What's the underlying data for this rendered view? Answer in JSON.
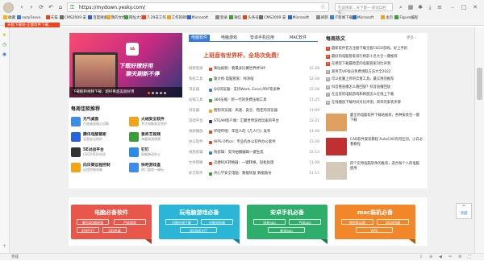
{
  "browser": {
    "url": "https://mydown.yesky.com/",
    "search_placeholder": "在此搜索…天下第一·新冠口腔科…",
    "tab_title": "天极下载站-正版软件下载…",
    "status_text": "完成",
    "bookmarks": [
      {
        "label": "收藏",
        "color": "#f5b400"
      },
      {
        "label": "sezy5ssvn",
        "color": "#3a7bd5"
      },
      {
        "label": "天猫",
        "color": "#e8431d"
      },
      {
        "label": "CMS2009 安",
        "color": "#6a6a6a"
      },
      {
        "label": "百度搜索",
        "color": "#2a62d8"
      },
      {
        "label": "我的文档",
        "color": "#f2a31c"
      },
      {
        "label": "网址大全",
        "color": "#3a9c3a"
      },
      {
        "label": "7.29日工作",
        "color": "#e8431d"
      },
      {
        "label": "工作的邮件",
        "color": "#f2a31c"
      },
      {
        "label": "Microsoft",
        "color": "#2a62d8"
      },
      {
        "label": "登录",
        "color": "#888888"
      },
      {
        "label": "微信",
        "color": "#3a9c3a"
      },
      {
        "label": "头条号",
        "color": "#e8431d"
      },
      {
        "label": "CMS2009 安",
        "color": "#6a6a6a"
      },
      {
        "label": "Microsoft",
        "color": "#2a62d8"
      },
      {
        "label": "刷新",
        "color": "#888888"
      },
      {
        "label": "IT新闻下载",
        "color": "#3a7bd5"
      },
      {
        "label": "Microsoft",
        "color": "#2a62d8"
      },
      {
        "label": "主页",
        "color": "#f2a31c"
      },
      {
        "label": "Figure编程",
        "color": "#3a9c3a"
      }
    ]
  },
  "banner": {
    "app_name": "VA",
    "slogan1": "下载好撩好用",
    "slogan2": "聊天刷新不停",
    "caption": "下载酷狗视频下载，超好看超美丽好用"
  },
  "soft_recommend": {
    "title": "每周佳软推荐",
    "items": [
      {
        "name": "元气桌面",
        "desc": "百变桌面随心切换",
        "color": "#3d8be8"
      },
      {
        "name": "火绒安全软件",
        "desc": "专注电脑安全防护",
        "color": "#f2a31c"
      },
      {
        "name": "腾讯电脑管家",
        "desc": "全面安全防护",
        "color": "#2a62d8"
      },
      {
        "name": "爱奇艺视频",
        "desc": "海量高清视频",
        "color": "#3a9c3a"
      },
      {
        "name": "5E对战平台",
        "desc": "CSGO竞技对战",
        "color": "#333333"
      },
      {
        "name": "钉钉",
        "desc": "智能移动办公",
        "color": "#2a8be8"
      },
      {
        "name": "向日葵远程控制",
        "desc": "远程控制电脑",
        "color": "#f2a31c"
      },
      {
        "name": "快吧游戏盒",
        "desc": "热门游戏一键玩",
        "color": "#3d8be8"
      }
    ]
  },
  "news_tabs": [
    "电脑软件",
    "电脑游戏",
    "安卓手机应用",
    "MAC软件"
  ],
  "headline": "上班音有世界杯，全场次免费！",
  "news": [
    {
      "cat": "网络电视",
      "title": "咪咕视频：看最多比赛世界杯VIP",
      "date": "12-28",
      "color": "#e8431d"
    },
    {
      "cat": "系统工具",
      "title": "鲁大师·电脑管家：纯净版",
      "date": "12-28",
      "color": "#3a9c3a"
    },
    {
      "cat": "浏览器",
      "title": "QQ浏览器：支持Word, Excel,PDF等多种",
      "date": "12-28",
      "color": "#3a7bd5"
    },
    {
      "cat": "压缩工具",
      "title": "360压缩：新一代的免费压缩工具",
      "date": "11-25",
      "color": "#3a9c3a"
    },
    {
      "cat": "浏览器",
      "title": "搜狗浏览器：高速、安全、稳定的浏览器",
      "date": "11-09",
      "color": "#f2a31c"
    },
    {
      "cat": "游戏平台",
      "title": "STEAM客户端：汇聚世界游戏玩家的平台",
      "date": "12-21",
      "color": "#2a3a78"
    },
    {
      "cat": "视频播放",
      "title": "哔哩哔哩：年轻人的《几人行》发布",
      "date": "11-26",
      "color": "#e8431d"
    },
    {
      "cat": "办公软件",
      "title": "WPS Office：专业的办公软件办公套件",
      "date": "12-20",
      "color": "#e8431d"
    },
    {
      "cat": "视频剪辑",
      "title": "快剪辑：支持拍摄编辑一键生成",
      "date": "12-14",
      "color": "#3a7bd5"
    },
    {
      "cat": "文件转换",
      "title": "迅捷PDF转换器：一键转换，轻松处理",
      "date": "11-08",
      "color": "#e8431d"
    },
    {
      "cat": "安全软件",
      "title": "开心学安全电脑：数据恢复 数据备份",
      "date": "11-11",
      "color": "#3a9c3a"
    }
  ],
  "hot": {
    "title": "每周热文",
    "more": "更多 ›",
    "items": [
      "最新软件官方注册下载全套CSGO游戏，好上手的",
      "最好的电脑管家排行榜前十名大全一键推荐",
      "在哪里下载最稳定的电脑管家对比评测",
      "爱奇艺VIP会员免费领取方法大全2022",
      "可以批量上传的云盘工具，最实用的推荐",
      "抖音看直播怎么看回放？抖音直播回放",
      "在这里的电脑游戏和网盘怎么在线上下载",
      "在线播放下载时间对比评测，简单的安装步骤"
    ],
    "thumbs": [
      {
        "text": "最全的电脑软件下载站推荐，各种安装包一键下载",
        "color": "#e0a060"
      },
      {
        "text": "CAD软件安装教程 AutoCAD有何区别，小白必看教程",
        "color": "#c03030"
      },
      {
        "text": "四个实用电脑软件的推荐，适合每个人的电脑使用",
        "color": "#d4c8b8"
      }
    ]
  },
  "cards": [
    {
      "title": "电脑必备软件",
      "color": "#e8574a",
      "fold": "#b23a2e",
      "pills": [
        "腾讯QQ最新版",
        "百度网盘",
        "阿里巴巴",
        "360杀毒"
      ]
    },
    {
      "title": "玩电脑游戏必备",
      "color": "#2bb6d8",
      "fold": "#1a7e97",
      "pills": [
        "迅雷在线下载",
        "谷歌浏览器",
        "QQ游戏大厅"
      ]
    },
    {
      "title": "安卓手机必备",
      "color": "#2fae6b",
      "fold": "#1d7a49",
      "pills": [
        "网易app",
        "百度app",
        "新浪app"
      ]
    },
    {
      "title": "mac装机必备",
      "color": "#f2872a",
      "fold": "#b35a12",
      "pills": [
        "微信Mac版",
        "QQ浏览器",
        "WPS"
      ]
    }
  ],
  "side_button": {
    "label": "顶部"
  }
}
